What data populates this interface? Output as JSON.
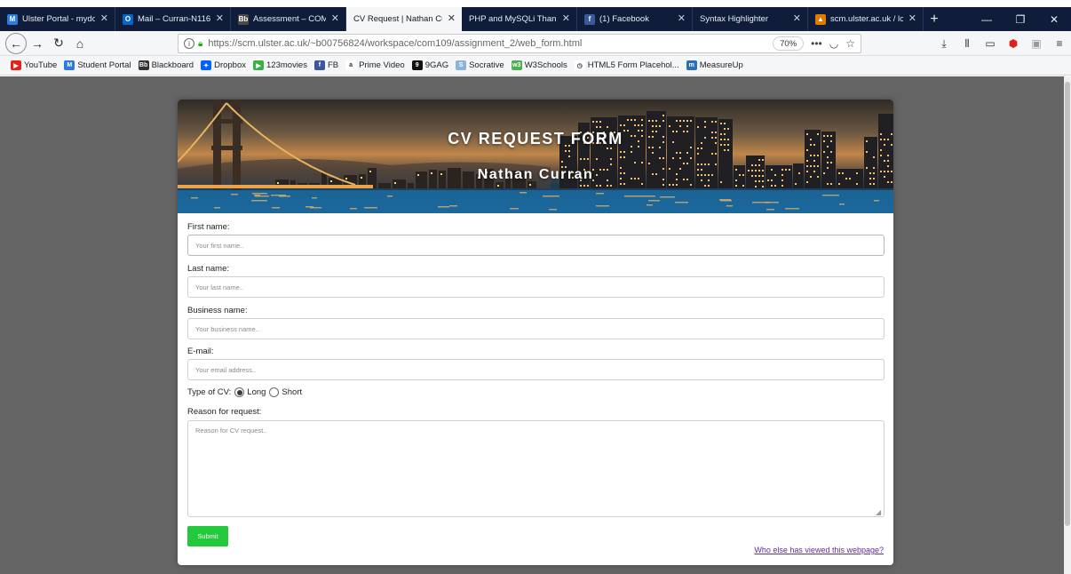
{
  "window": {
    "tabs": [
      {
        "label": "Ulster Portal - mydo",
        "icon_text": "M",
        "icon_color": "#2c7be5",
        "active": false
      },
      {
        "label": "Mail – Curran-N116",
        "icon_text": "O",
        "icon_color": "#0a64c8",
        "active": false
      },
      {
        "label": "Assessment – COM",
        "icon_text": "Bb",
        "icon_color": "#4a4a4a",
        "active": false
      },
      {
        "label": "CV Request | Nathan Cu",
        "icon_text": "",
        "icon_color": "",
        "active": true
      },
      {
        "label": "PHP and MySQLi Thank",
        "icon_text": "",
        "icon_color": "",
        "active": false
      },
      {
        "label": "(1) Facebook",
        "icon_text": "f",
        "icon_color": "#3b5998",
        "active": false
      },
      {
        "label": "Syntax Highlighter",
        "icon_text": "",
        "icon_color": "",
        "active": false
      },
      {
        "label": "scm.ulster.ac.uk / lo",
        "icon_text": "▲",
        "icon_color": "#e07b00",
        "active": false
      }
    ]
  },
  "navbar": {
    "url": "https://scm.ulster.ac.uk/~b00756824/workspace/com109/assignment_2/web_form.html",
    "zoom": "70%"
  },
  "bookmarks": [
    {
      "label": "YouTube",
      "icon_color": "#e62117",
      "icon_text": "▶"
    },
    {
      "label": "Student Portal",
      "icon_color": "#2c7be5",
      "icon_text": "M"
    },
    {
      "label": "Blackboard",
      "icon_color": "#333333",
      "icon_text": "Bb"
    },
    {
      "label": "Dropbox",
      "icon_color": "#0061ff",
      "icon_text": "✦"
    },
    {
      "label": "123movies",
      "icon_color": "#3cb043",
      "icon_text": "▶"
    },
    {
      "label": "FB",
      "icon_color": "#3b5998",
      "icon_text": "f"
    },
    {
      "label": "Prime Video",
      "icon_color": "#ffffff",
      "icon_text": "a"
    },
    {
      "label": "9GAG",
      "icon_color": "#111111",
      "icon_text": "9"
    },
    {
      "label": "Socrative",
      "icon_color": "#8ab4d8",
      "icon_text": "S"
    },
    {
      "label": "W3Schools",
      "icon_color": "#4caf50",
      "icon_text": "w3"
    },
    {
      "label": "HTML5 Form Placehol...",
      "icon_color": "#ffffff",
      "icon_text": "◷"
    },
    {
      "label": "MeasureUp",
      "icon_color": "#2a6fbe",
      "icon_text": "m"
    }
  ],
  "page": {
    "title": "CV REQUEST FORM",
    "name": "Nathan Curran",
    "first_name_label": "First name:",
    "first_name_placeholder": "Your first name..",
    "last_name_label": "Last name:",
    "last_name_placeholder": "Your last name..",
    "business_label": "Business name:",
    "business_placeholder": "Your business name..",
    "email_label": "E-mail:",
    "email_placeholder": "Your email address..",
    "cv_type_label": "Type of CV:",
    "cv_type_options": [
      "Long",
      "Short"
    ],
    "cv_type_selected": "Long",
    "reason_label": "Reason for request:",
    "reason_placeholder": "Reason for CV request..",
    "submit_label": "Submit",
    "viewers_link": "Who else has viewed this webpage?"
  },
  "colors": {
    "tabbar": "#0f1c3a",
    "page_background": "#646464",
    "submit": "#22c93a",
    "link": "#5a2ea6"
  }
}
